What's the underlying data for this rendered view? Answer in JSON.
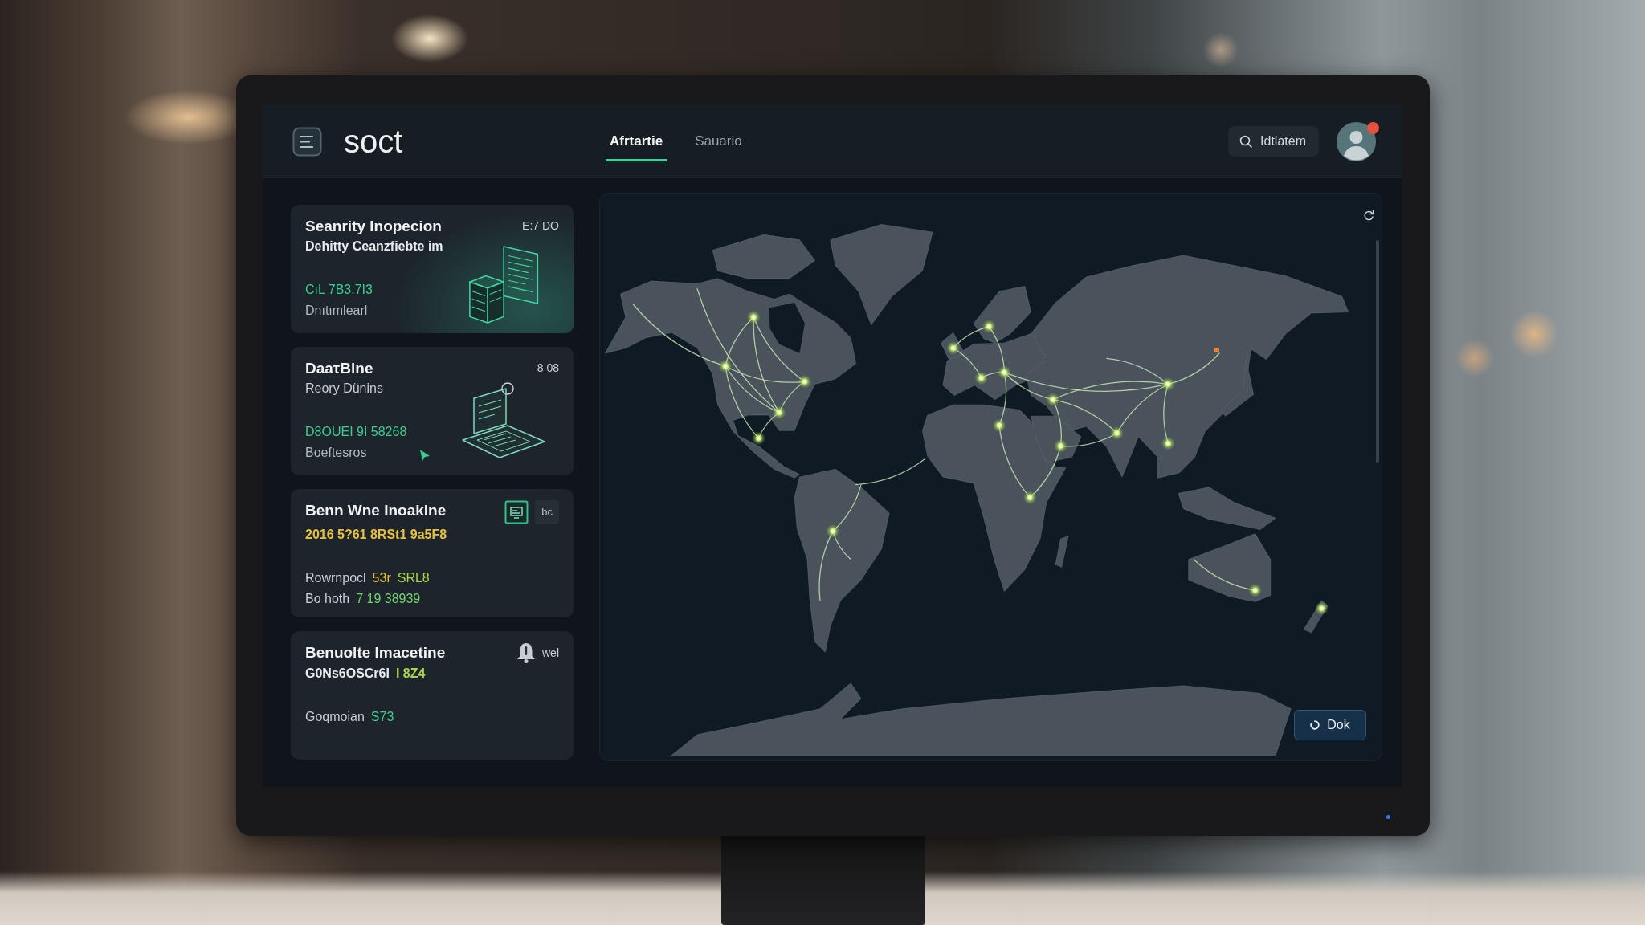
{
  "header": {
    "logo": "soct",
    "tabs": [
      {
        "label": "Afrtartie",
        "selected": true
      },
      {
        "label": "Sauario",
        "selected": false
      }
    ],
    "search": {
      "label": "Idtlatem"
    },
    "avatar": {
      "notification": true
    }
  },
  "cards": [
    {
      "kind": "report",
      "title": "Seanrity Inopecion",
      "meta": "E:7 DO",
      "subtitle": [
        {
          "text": "Dehitty Ceanzfiebte im",
          "color": "#e8ebee"
        }
      ],
      "details": [
        [
          {
            "text": "CıL 7B3.7I3",
            "color": "#3ccf8c"
          }
        ],
        [
          {
            "text": "Dnıtımlearl",
            "color": "#b4bbc2"
          }
        ]
      ]
    },
    {
      "kind": "device",
      "title": "DaaτBine",
      "meta": "8 08",
      "subtitle": [
        {
          "text": "Reory Dünins",
          "color": "#c9ced3"
        }
      ],
      "details": [
        [
          {
            "text": "D8OUEI 9I 58268",
            "color": "#3ccf8c"
          }
        ],
        [
          {
            "text": "Boeftesros",
            "color": "#b4bbc2"
          }
        ]
      ]
    },
    {
      "kind": "monitor",
      "title": "Benn Wne Inoakine",
      "meta": "bc",
      "subtitle": [
        {
          "text": "2016 5?61 8RSt1 9a5F8",
          "color": "#e6c23a"
        }
      ],
      "details": [
        [
          {
            "text": "Rowrnpocl",
            "color": "#c9ced3"
          },
          {
            "text": "53r",
            "color": "#e6c23a"
          },
          {
            "text": "SRL8",
            "color": "#a6d64a"
          }
        ],
        [
          {
            "text": "Bo hoth",
            "color": "#c9ced3"
          },
          {
            "text": "7 19 38939",
            "color": "#6fd36a"
          }
        ]
      ]
    },
    {
      "kind": "alert",
      "title": "Benuolte Imacetine",
      "meta": "wel",
      "subtitle": [
        {
          "text": "G0Ns6OSCr6I",
          "color": "#e8ebee"
        },
        {
          "text": "I 8Z4",
          "color": "#a6d64a"
        }
      ],
      "details": [
        [
          {
            "text": "Goqmoian",
            "color": "#c9ced3"
          },
          {
            "text": "S73",
            "color": "#3ccf8c"
          }
        ]
      ]
    }
  ],
  "map": {
    "button": "Dok"
  }
}
